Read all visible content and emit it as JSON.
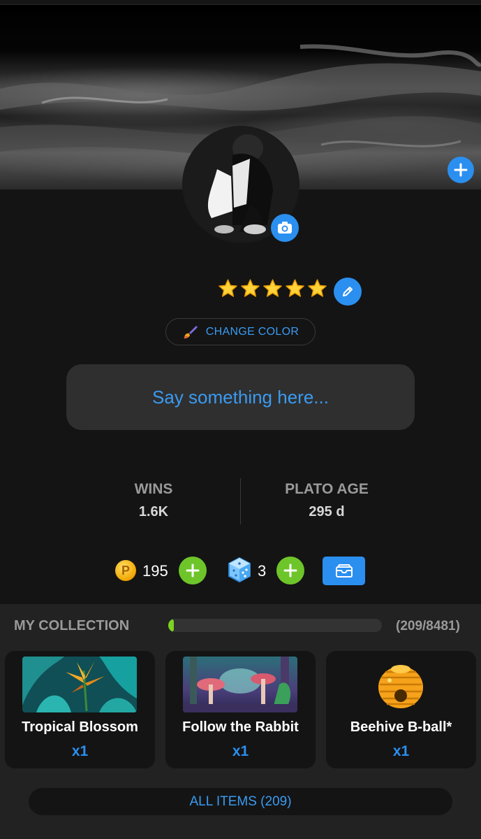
{
  "profile": {
    "stars": [
      "star",
      "star",
      "star",
      "star",
      "star"
    ],
    "change_color_label": "CHANGE COLOR",
    "status_placeholder": "Say something here..."
  },
  "stats": [
    {
      "label": "WINS",
      "value": "1.6K"
    },
    {
      "label": "PLATO AGE",
      "value": "295 d"
    }
  ],
  "currency": {
    "coins": "195",
    "coin_symbol": "P",
    "dice": "3"
  },
  "collection": {
    "title": "MY COLLECTION",
    "progress_fraction": 0.0246,
    "count": "(209/8481)",
    "items": [
      {
        "name": "Tropical Blossom",
        "qty": "x1"
      },
      {
        "name": "Follow the Rabbit",
        "qty": "x1"
      },
      {
        "name": "Beehive B-ball*",
        "qty": "x1"
      }
    ],
    "all_items_label": "ALL ITEMS (209)"
  },
  "colors": {
    "accent_blue": "#2b8ff0",
    "accent_green": "#7ed321",
    "background": "#141414",
    "panel": "#222222"
  },
  "icons": {
    "cover_add": "plus-icon",
    "camera": "camera-icon",
    "edit": "pencil-icon",
    "brush": "paintbrush-icon",
    "coin": "coin-icon",
    "dice": "dice-icon",
    "wallet": "wallet-icon"
  }
}
